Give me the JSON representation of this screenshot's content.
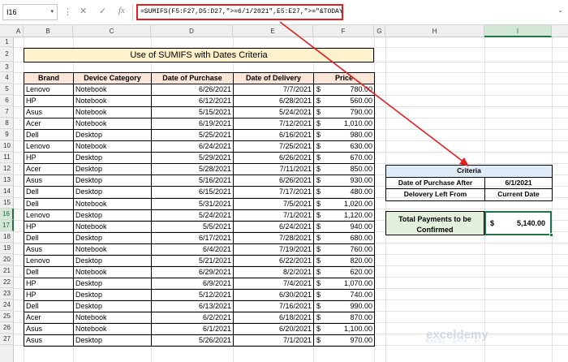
{
  "namebox": "I16",
  "formula": "=SUMIFS(F5:F27,D5:D27,\">=6/1/2021\",E5:E27,\">=\"&TODAY())",
  "columns": [
    "A",
    "B",
    "C",
    "D",
    "E",
    "F",
    "G",
    "H",
    "I"
  ],
  "rows": [
    "1",
    "2",
    "3",
    "4",
    "5",
    "6",
    "7",
    "8",
    "9",
    "10",
    "11",
    "12",
    "13",
    "14",
    "15",
    "16",
    "17",
    "18",
    "19",
    "20",
    "21",
    "22",
    "23",
    "24",
    "25",
    "26",
    "27"
  ],
  "title": "Use of SUMIFS with Dates Criteria",
  "table": {
    "headers": [
      "Brand",
      "Device Category",
      "Date of Purchase",
      "Date of Delivery",
      "Price"
    ],
    "currency": "$",
    "rows": [
      [
        "Lenovo",
        "Notebook",
        "6/26/2021",
        "7/7/2021",
        "780.00"
      ],
      [
        "HP",
        "Notebook",
        "6/12/2021",
        "6/28/2021",
        "560.00"
      ],
      [
        "Asus",
        "Notebook",
        "5/15/2021",
        "5/24/2021",
        "790.00"
      ],
      [
        "Acer",
        "Notebook",
        "6/19/2021",
        "7/12/2021",
        "1,010.00"
      ],
      [
        "Dell",
        "Desktop",
        "5/25/2021",
        "6/16/2021",
        "980.00"
      ],
      [
        "Lenovo",
        "Notebook",
        "6/24/2021",
        "7/25/2021",
        "630.00"
      ],
      [
        "HP",
        "Desktop",
        "5/29/2021",
        "6/26/2021",
        "670.00"
      ],
      [
        "Acer",
        "Desktop",
        "5/28/2021",
        "7/11/2021",
        "850.00"
      ],
      [
        "Asus",
        "Desktop",
        "5/16/2021",
        "6/26/2021",
        "930.00"
      ],
      [
        "Dell",
        "Desktop",
        "6/15/2021",
        "7/17/2021",
        "480.00"
      ],
      [
        "Dell",
        "Notebook",
        "5/31/2021",
        "7/5/2021",
        "1,020.00"
      ],
      [
        "Lenovo",
        "Desktop",
        "5/24/2021",
        "7/1/2021",
        "1,120.00"
      ],
      [
        "HP",
        "Notebook",
        "5/5/2021",
        "6/24/2021",
        "940.00"
      ],
      [
        "Dell",
        "Desktop",
        "6/17/2021",
        "7/28/2021",
        "680.00"
      ],
      [
        "Asus",
        "Notebook",
        "6/4/2021",
        "7/19/2021",
        "760.00"
      ],
      [
        "Lenovo",
        "Desktop",
        "5/21/2021",
        "6/22/2021",
        "820.00"
      ],
      [
        "Dell",
        "Notebook",
        "6/29/2021",
        "8/2/2021",
        "620.00"
      ],
      [
        "HP",
        "Desktop",
        "6/9/2021",
        "7/4/2021",
        "1,070.00"
      ],
      [
        "HP",
        "Desktop",
        "5/12/2021",
        "6/30/2021",
        "740.00"
      ],
      [
        "Dell",
        "Desktop",
        "6/13/2021",
        "7/16/2021",
        "990.00"
      ],
      [
        "Acer",
        "Notebook",
        "6/2/2021",
        "6/18/2021",
        "870.00"
      ],
      [
        "Asus",
        "Notebook",
        "6/1/2021",
        "6/20/2021",
        "1,100.00"
      ],
      [
        "Asus",
        "Desktop",
        "5/26/2021",
        "7/1/2021",
        "970.00"
      ]
    ]
  },
  "criteria": {
    "title": "Criteria",
    "row1_label": "Date of Purchase After",
    "row1_value": "6/1/2021",
    "row2_label": "Delovery Left From",
    "row2_value": "Current Date"
  },
  "total": {
    "label": "Total Payments to be Confirmed",
    "currency": "$",
    "value": "5,140.00"
  },
  "colors": {
    "title_bg": "#fff2cc",
    "header_bg": "#fbe5d6",
    "criteria_bg": "#ddebf7",
    "total_bg": "#e2efda",
    "highlight": "#e02020",
    "selection": "#217346"
  },
  "icons": [
    "cancel-icon",
    "enter-icon",
    "function-icon",
    "dropdown-icon",
    "expand-icon"
  ]
}
